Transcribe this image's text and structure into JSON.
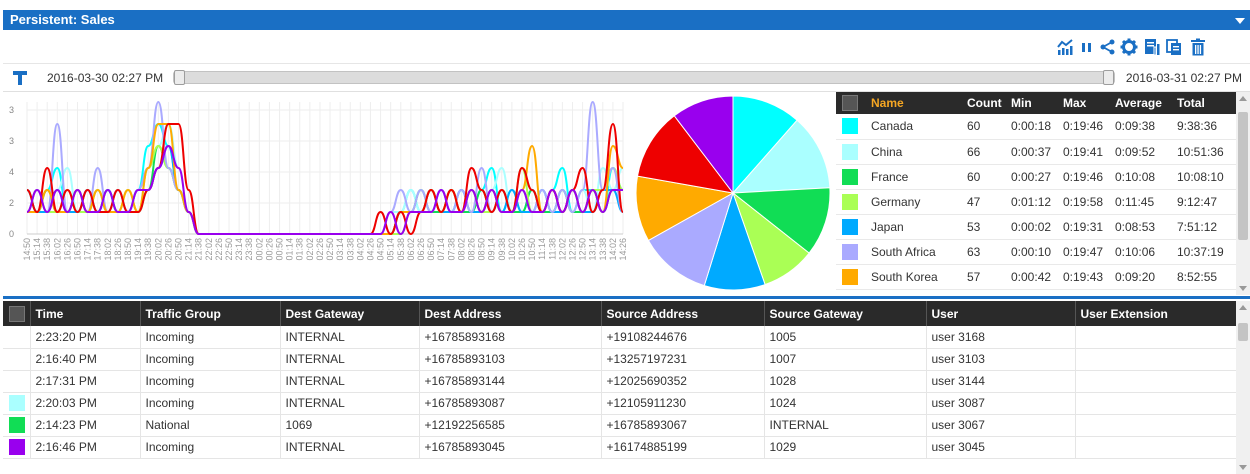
{
  "panel": {
    "title": "Persistent: Sales"
  },
  "toolbar": {
    "icons": [
      "chart-icon",
      "pause-icon",
      "share-icon",
      "gear-icon",
      "report-icon",
      "copy-icon",
      "trash-icon"
    ]
  },
  "timeline": {
    "start_label": "2016-03-30 02:27 PM",
    "end_label": "2016-03-31 02:27 PM",
    "selection_start": 0.0,
    "selection_end": 1.0
  },
  "summary": {
    "columns": [
      "Name",
      "Count",
      "Min",
      "Max",
      "Average",
      "Total"
    ],
    "rows": [
      {
        "color": "#00ffff",
        "name": "Canada",
        "count": "60",
        "min": "0:00:18",
        "max": "0:19:46",
        "avg": "0:09:38",
        "total": "9:38:36"
      },
      {
        "color": "#aaffff",
        "name": "China",
        "count": "66",
        "min": "0:00:37",
        "max": "0:19:41",
        "avg": "0:09:52",
        "total": "10:51:36"
      },
      {
        "color": "#11dd55",
        "name": "France",
        "count": "60",
        "min": "0:00:27",
        "max": "0:19:46",
        "avg": "0:10:08",
        "total": "10:08:10"
      },
      {
        "color": "#aaff55",
        "name": "Germany",
        "count": "47",
        "min": "0:01:12",
        "max": "0:19:58",
        "avg": "0:11:45",
        "total": "9:12:47"
      },
      {
        "color": "#00aaff",
        "name": "Japan",
        "count": "53",
        "min": "0:00:02",
        "max": "0:19:31",
        "avg": "0:08:53",
        "total": "7:51:12"
      },
      {
        "color": "#aaaaff",
        "name": "South Africa",
        "count": "63",
        "min": "0:00:10",
        "max": "0:19:47",
        "avg": "0:10:06",
        "total": "10:37:19"
      },
      {
        "color": "#ffaa00",
        "name": "South Korea",
        "count": "57",
        "min": "0:00:42",
        "max": "0:19:43",
        "avg": "0:09:20",
        "total": "8:52:55"
      }
    ]
  },
  "chart_data": [
    {
      "type": "line",
      "ylim": [
        0,
        6
      ],
      "y_ticks": [
        "3",
        "3",
        "4",
        "2",
        "0"
      ],
      "x": [
        "14:50",
        "15:14",
        "15:38",
        "16:02",
        "16:26",
        "16:50",
        "17:14",
        "17:38",
        "18:02",
        "18:26",
        "18:50",
        "19:14",
        "19:38",
        "20:02",
        "20:26",
        "20:50",
        "21:14",
        "21:38",
        "22:02",
        "22:26",
        "22:50",
        "23:14",
        "23:38",
        "00:02",
        "00:26",
        "00:50",
        "01:14",
        "01:38",
        "02:02",
        "02:26",
        "02:50",
        "03:14",
        "03:38",
        "04:02",
        "04:26",
        "04:50",
        "05:14",
        "05:38",
        "06:02",
        "06:26",
        "06:50",
        "07:14",
        "07:38",
        "08:02",
        "08:26",
        "08:50",
        "09:14",
        "09:38",
        "10:02",
        "10:26",
        "10:50",
        "11:14",
        "11:38",
        "12:02",
        "12:26",
        "12:50",
        "13:14",
        "13:38",
        "14:02",
        "14:26"
      ],
      "series": [
        {
          "color": "#00ffff",
          "values": [
            2,
            1,
            2,
            3,
            1,
            2,
            1,
            2,
            1,
            2,
            1,
            2,
            4,
            5,
            4,
            2,
            1,
            0,
            0,
            0,
            0,
            0,
            0,
            0,
            0,
            0,
            0,
            0,
            0,
            0,
            0,
            0,
            0,
            0,
            0,
            0,
            0,
            1,
            2,
            1,
            1,
            2,
            1,
            2,
            1,
            2,
            3,
            1,
            2,
            1,
            2,
            1,
            2,
            3,
            1,
            2,
            2,
            1,
            3,
            2
          ]
        },
        {
          "color": "#aaffff",
          "values": [
            1,
            2,
            1,
            2,
            3,
            1,
            2,
            1,
            2,
            1,
            2,
            1,
            3,
            4,
            5,
            3,
            1,
            0,
            0,
            0,
            0,
            0,
            0,
            0,
            0,
            0,
            0,
            0,
            0,
            0,
            0,
            0,
            0,
            0,
            0,
            0,
            1,
            1,
            2,
            1,
            2,
            1,
            1,
            2,
            1,
            1,
            2,
            3,
            1,
            2,
            1,
            2,
            1,
            2,
            1,
            2,
            1,
            3,
            2,
            3
          ]
        },
        {
          "color": "#11dd55",
          "values": [
            1,
            1,
            2,
            1,
            1,
            2,
            1,
            1,
            2,
            1,
            1,
            1,
            2,
            4,
            3,
            2,
            1,
            0,
            0,
            0,
            0,
            0,
            0,
            0,
            0,
            0,
            0,
            0,
            0,
            0,
            0,
            0,
            0,
            0,
            0,
            0,
            0,
            1,
            1,
            2,
            1,
            1,
            2,
            1,
            1,
            2,
            1,
            2,
            1,
            1,
            2,
            1,
            1,
            2,
            1,
            1,
            2,
            1,
            2,
            2
          ]
        },
        {
          "color": "#aaff55",
          "values": [
            1,
            2,
            1,
            1,
            2,
            1,
            1,
            2,
            1,
            1,
            2,
            1,
            3,
            4,
            3,
            2,
            1,
            0,
            0,
            0,
            0,
            0,
            0,
            0,
            0,
            0,
            0,
            0,
            0,
            0,
            0,
            0,
            0,
            0,
            0,
            0,
            0,
            0,
            1,
            1,
            2,
            1,
            2,
            1,
            2,
            1,
            1,
            2,
            1,
            3,
            1,
            1,
            2,
            1,
            2,
            1,
            2,
            2,
            3,
            2
          ]
        },
        {
          "color": "#00aaff",
          "values": [
            2,
            1,
            1,
            2,
            1,
            1,
            2,
            1,
            2,
            1,
            1,
            2,
            2,
            3,
            4,
            2,
            1,
            0,
            0,
            0,
            0,
            0,
            0,
            0,
            0,
            0,
            0,
            0,
            0,
            0,
            0,
            0,
            0,
            0,
            0,
            0,
            0,
            1,
            1,
            1,
            2,
            1,
            1,
            2,
            1,
            1,
            2,
            1,
            2,
            1,
            1,
            2,
            1,
            1,
            2,
            1,
            1,
            2,
            2,
            1
          ]
        },
        {
          "color": "#aaaaff",
          "values": [
            1,
            2,
            1,
            5,
            1,
            2,
            1,
            3,
            1,
            2,
            1,
            2,
            3,
            6,
            3,
            2,
            1,
            0,
            0,
            0,
            0,
            0,
            0,
            0,
            0,
            0,
            0,
            0,
            0,
            0,
            0,
            0,
            0,
            0,
            0,
            0,
            1,
            2,
            1,
            2,
            1,
            2,
            1,
            2,
            1,
            3,
            1,
            2,
            1,
            2,
            1,
            2,
            1,
            2,
            1,
            2,
            6,
            2,
            3,
            1
          ]
        },
        {
          "color": "#ffaa00",
          "values": [
            1,
            1,
            2,
            1,
            1,
            2,
            1,
            2,
            1,
            1,
            2,
            1,
            3,
            5,
            5,
            2,
            1,
            0,
            0,
            0,
            0,
            0,
            0,
            0,
            0,
            0,
            0,
            0,
            0,
            0,
            0,
            0,
            0,
            0,
            0,
            0,
            0,
            1,
            1,
            1,
            2,
            1,
            2,
            1,
            2,
            1,
            2,
            1,
            1,
            2,
            4,
            1,
            2,
            1,
            2,
            1,
            2,
            1,
            4,
            3
          ]
        },
        {
          "color": "#ee0000",
          "values": [
            2,
            1,
            3,
            1,
            2,
            1,
            2,
            1,
            1,
            2,
            1,
            1,
            2,
            3,
            5,
            5,
            2,
            0,
            0,
            0,
            0,
            0,
            0,
            0,
            0,
            0,
            0,
            0,
            0,
            0,
            0,
            0,
            0,
            0,
            0,
            1,
            0,
            1,
            0,
            1,
            2,
            1,
            2,
            1,
            3,
            2,
            1,
            2,
            1,
            3,
            2,
            1,
            2,
            1,
            2,
            3,
            1,
            2,
            5,
            1
          ]
        },
        {
          "color": "#9900ee",
          "values": [
            1,
            2,
            1,
            2,
            1,
            2,
            1,
            1,
            2,
            1,
            1,
            2,
            2,
            3,
            4,
            3,
            1,
            0,
            0,
            0,
            0,
            0,
            0,
            0,
            0,
            0,
            0,
            0,
            0,
            0,
            0,
            0,
            0,
            0,
            0,
            0,
            1,
            0,
            1,
            1,
            1,
            2,
            1,
            1,
            2,
            1,
            2,
            1,
            1,
            2,
            1,
            1,
            2,
            1,
            2,
            1,
            2,
            1,
            2,
            2
          ]
        }
      ]
    },
    {
      "type": "pie",
      "slices": [
        {
          "color": "#00ffff",
          "value": 60
        },
        {
          "color": "#aaffff",
          "value": 66
        },
        {
          "color": "#11dd55",
          "value": 60
        },
        {
          "color": "#aaff55",
          "value": 47
        },
        {
          "color": "#00aaff",
          "value": 53
        },
        {
          "color": "#aaaaff",
          "value": 63
        },
        {
          "color": "#ffaa00",
          "value": 57
        },
        {
          "color": "#ee0000",
          "value": 62
        },
        {
          "color": "#9900ee",
          "value": 54
        }
      ]
    }
  ],
  "details": {
    "columns": [
      "Time",
      "Traffic Group",
      "Dest Gateway",
      "Dest Address",
      "Source Address",
      "Source Gateway",
      "User",
      "User Extension"
    ],
    "rows": [
      {
        "color": "",
        "time": "2:23:20 PM",
        "group": "Incoming",
        "dgw": "INTERNAL",
        "daddr": "+16785893168",
        "saddr": "+19108244676",
        "sgw": "1005",
        "user": "user 3168",
        "ext": ""
      },
      {
        "color": "",
        "time": "2:16:40 PM",
        "group": "Incoming",
        "dgw": "INTERNAL",
        "daddr": "+16785893103",
        "saddr": "+13257197231",
        "sgw": "1007",
        "user": "user 3103",
        "ext": ""
      },
      {
        "color": "",
        "time": "2:17:31 PM",
        "group": "Incoming",
        "dgw": "INTERNAL",
        "daddr": "+16785893144",
        "saddr": "+12025690352",
        "sgw": "1028",
        "user": "user 3144",
        "ext": ""
      },
      {
        "color": "#aaffff",
        "time": "2:20:03 PM",
        "group": "Incoming",
        "dgw": "INTERNAL",
        "daddr": "+16785893087",
        "saddr": "+12105911230",
        "sgw": "1024",
        "user": "user 3087",
        "ext": ""
      },
      {
        "color": "#11dd55",
        "time": "2:14:23 PM",
        "group": "National",
        "dgw": "1069",
        "daddr": "+12192256585",
        "saddr": "+16785893067",
        "sgw": "INTERNAL",
        "user": "user 3067",
        "ext": ""
      },
      {
        "color": "#9900ee",
        "time": "2:16:46 PM",
        "group": "Incoming",
        "dgw": "INTERNAL",
        "daddr": "+16785893045",
        "saddr": "+16174885199",
        "sgw": "1029",
        "user": "user 3045",
        "ext": ""
      }
    ]
  }
}
